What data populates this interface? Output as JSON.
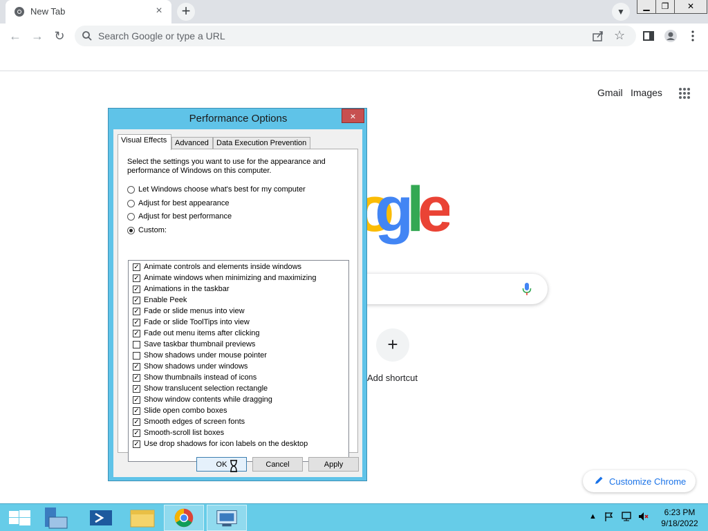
{
  "browser": {
    "tab_title": "New Tab",
    "tab_close": "×",
    "new_tab": "+",
    "omnibox_placeholder": "Search Google or type a URL"
  },
  "ntp": {
    "gmail": "Gmail",
    "images": "Images",
    "logo_visible": "gle",
    "add_shortcut_label": "Add shortcut",
    "customize_label": "Customize Chrome"
  },
  "dialog": {
    "title": "Performance Options",
    "close": "×",
    "tabs": [
      "Visual Effects",
      "Advanced",
      "Data Execution Prevention"
    ],
    "description": "Select the settings you want to use for the appearance and performance of Windows on this computer.",
    "radios": [
      {
        "label": "Let Windows choose what's best for my computer",
        "selected": false
      },
      {
        "label": "Adjust for best appearance",
        "selected": false
      },
      {
        "label": "Adjust for best performance",
        "selected": false
      },
      {
        "label": "Custom:",
        "selected": true
      }
    ],
    "effects": [
      {
        "label": "Animate controls and elements inside windows",
        "checked": true
      },
      {
        "label": "Animate windows when minimizing and maximizing",
        "checked": true
      },
      {
        "label": "Animations in the taskbar",
        "checked": true
      },
      {
        "label": "Enable Peek",
        "checked": true
      },
      {
        "label": "Fade or slide menus into view",
        "checked": true
      },
      {
        "label": "Fade or slide ToolTips into view",
        "checked": true
      },
      {
        "label": "Fade out menu items after clicking",
        "checked": true
      },
      {
        "label": "Save taskbar thumbnail previews",
        "checked": false
      },
      {
        "label": "Show shadows under mouse pointer",
        "checked": false
      },
      {
        "label": "Show shadows under windows",
        "checked": true
      },
      {
        "label": "Show thumbnails instead of icons",
        "checked": true
      },
      {
        "label": "Show translucent selection rectangle",
        "checked": true
      },
      {
        "label": "Show window contents while dragging",
        "checked": true
      },
      {
        "label": "Slide open combo boxes",
        "checked": true
      },
      {
        "label": "Smooth edges of screen fonts",
        "checked": true
      },
      {
        "label": "Smooth-scroll list boxes",
        "checked": true
      },
      {
        "label": "Use drop shadows for icon labels on the desktop",
        "checked": true
      }
    ],
    "buttons": {
      "ok": "OK",
      "cancel": "Cancel",
      "apply": "Apply"
    }
  },
  "taskbar": {
    "time": "6:23 PM",
    "date": "9/18/2022",
    "items": [
      "start-button",
      "server-manager",
      "powershell",
      "file-explorer",
      "chrome",
      "system-properties"
    ]
  },
  "colors": {
    "taskbar": "#66cce8",
    "dialog_frame": "#5fc3e8",
    "close_button": "#c75050",
    "google_blue": "#4285f4",
    "google_red": "#ea4335",
    "google_yellow": "#fbbc05",
    "google_green": "#34a853"
  }
}
